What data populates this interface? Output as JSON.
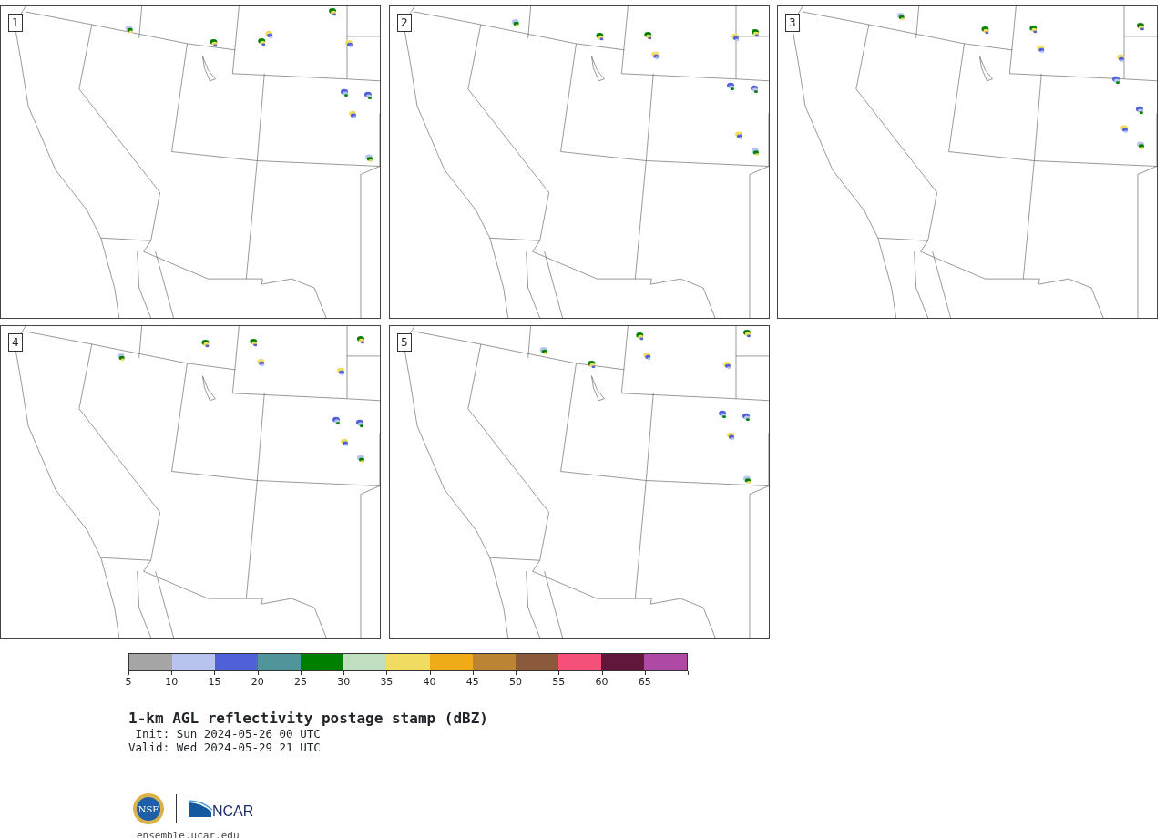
{
  "panels": [
    {
      "label": "1"
    },
    {
      "label": "2"
    },
    {
      "label": "3"
    },
    {
      "label": "4"
    },
    {
      "label": "5"
    }
  ],
  "colorbar": {
    "segments": [
      {
        "color": "#a5a5a5"
      },
      {
        "color": "#b8c4ee"
      },
      {
        "color": "#5060d8"
      },
      {
        "color": "#4f9599"
      },
      {
        "color": "#008000"
      },
      {
        "color": "#c0dfc0"
      },
      {
        "color": "#f0dc60"
      },
      {
        "color": "#f0ac18"
      },
      {
        "color": "#bb8333"
      },
      {
        "color": "#8b5a3c"
      },
      {
        "color": "#f5507a"
      },
      {
        "color": "#62163a"
      },
      {
        "color": "#ae4aa6"
      }
    ],
    "ticks": [
      "5",
      "10",
      "15",
      "20",
      "25",
      "30",
      "35",
      "40",
      "45",
      "50",
      "55",
      "60",
      "65"
    ]
  },
  "title": "1-km AGL reflectivity postage stamp (dBZ)",
  "init": " Init: Sun 2024-05-26 00 UTC",
  "valid": "Valid: Wed 2024-05-29 21 UTC",
  "logos": {
    "nsf": "NSF",
    "ncar": "NCAR"
  },
  "footer_url": "ensemble.ucar.edu"
}
